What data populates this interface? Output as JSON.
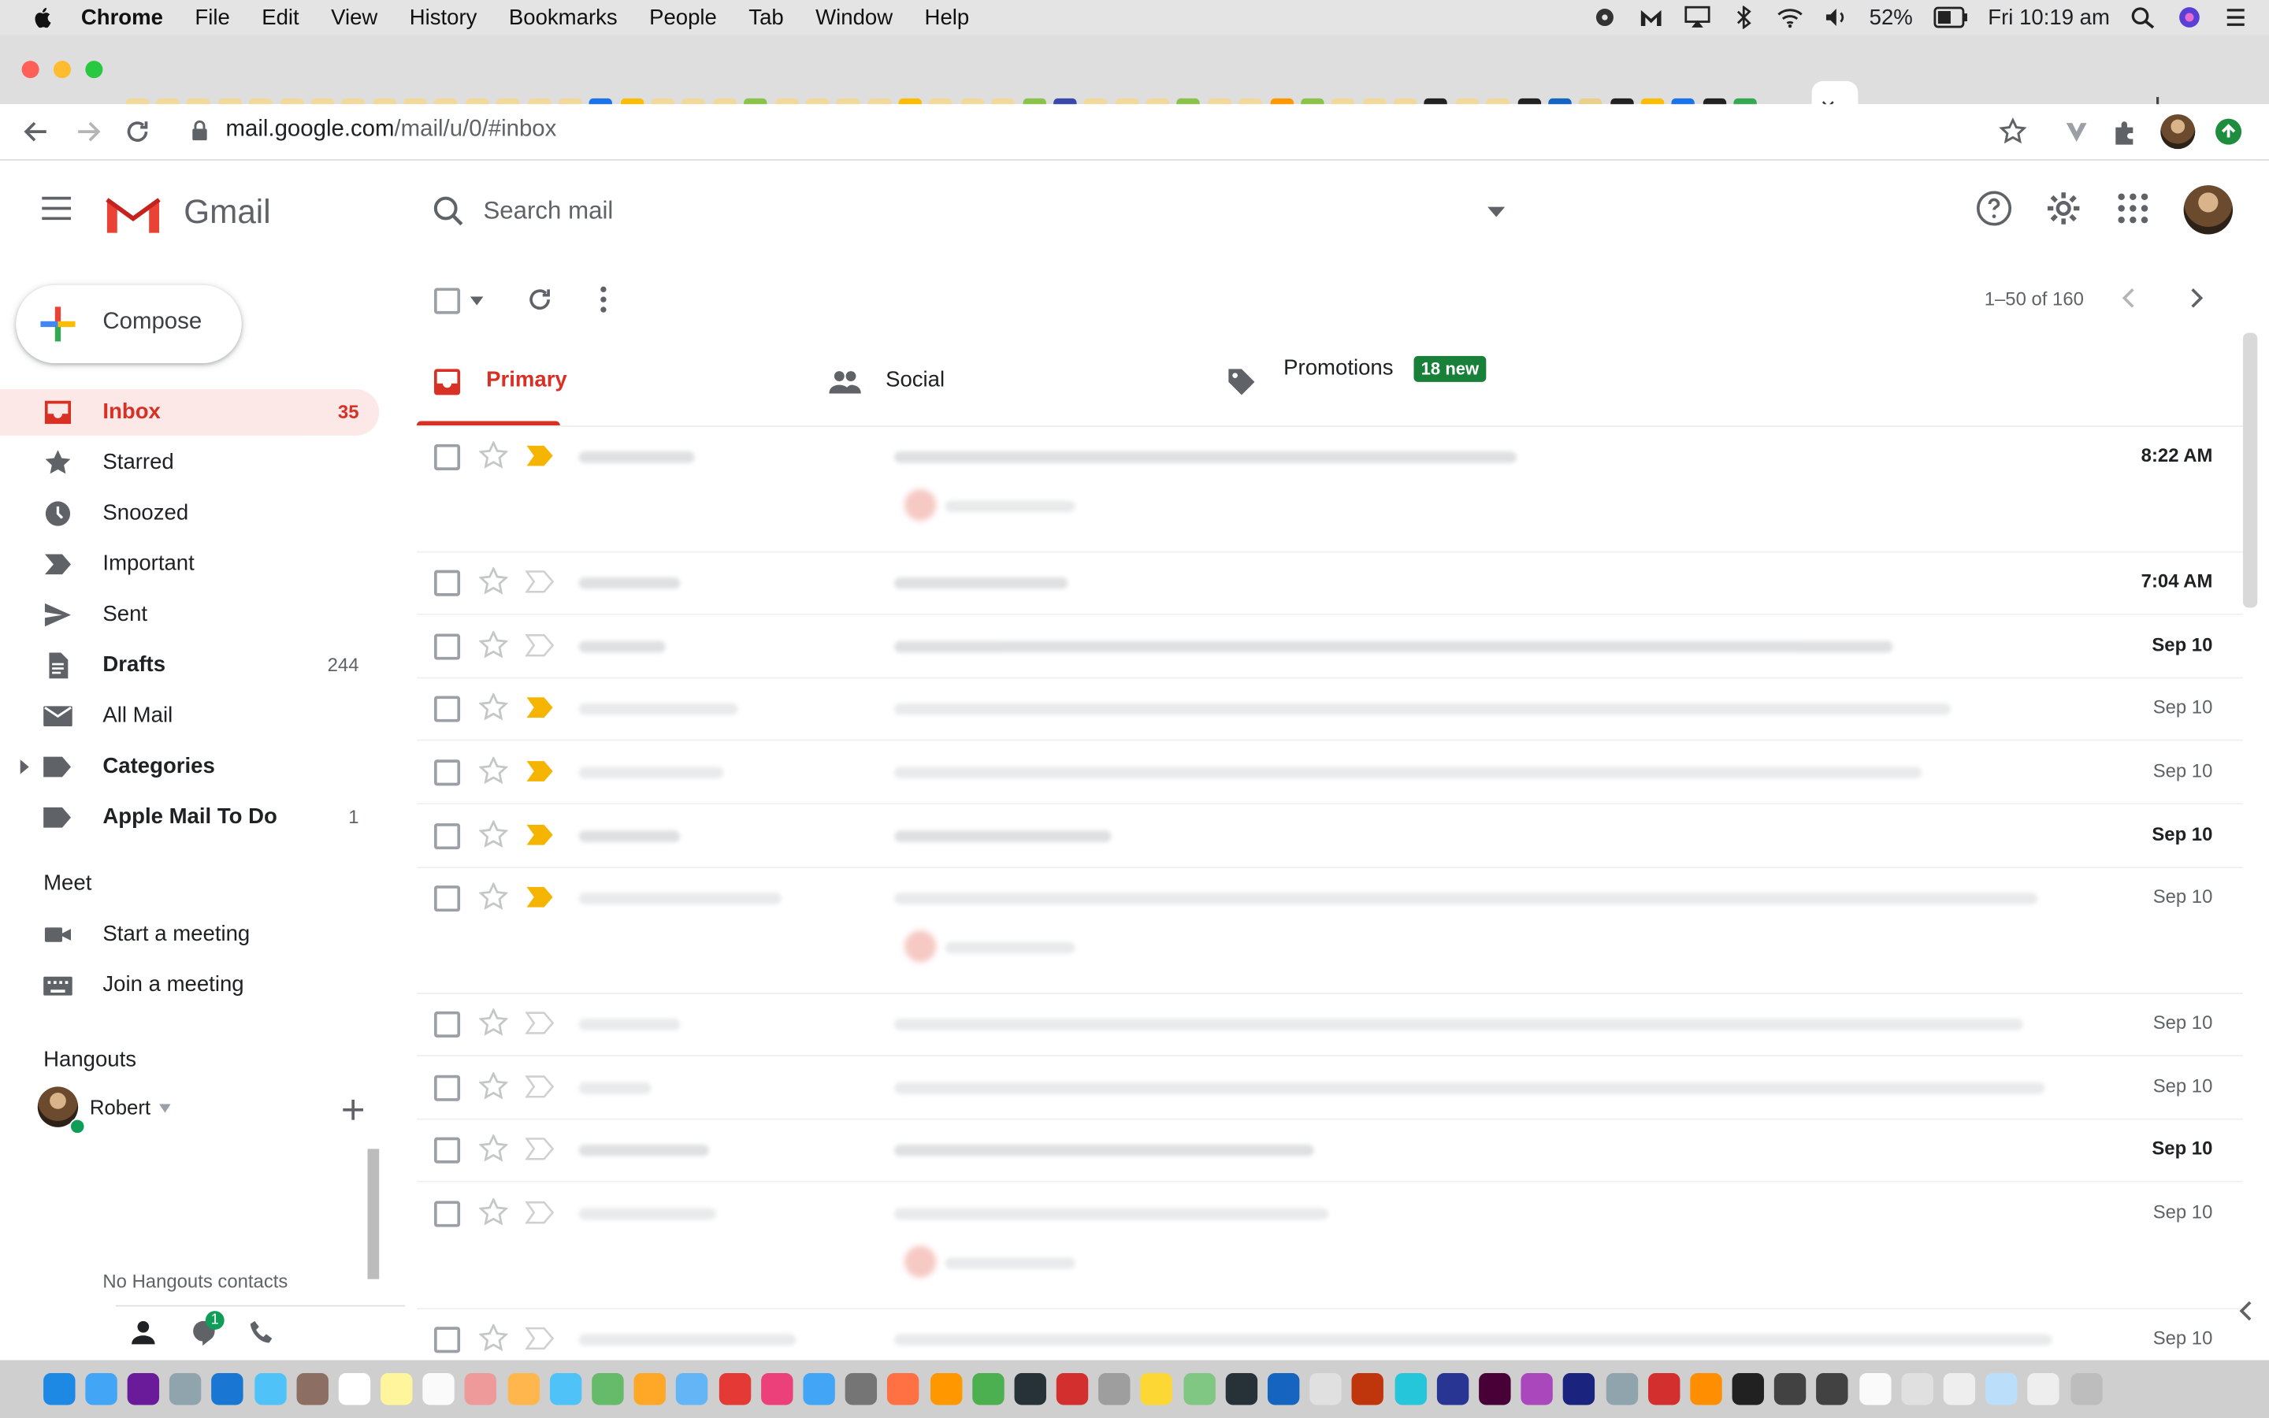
{
  "menubar": {
    "app": "Chrome",
    "items": [
      "File",
      "Edit",
      "View",
      "History",
      "Bookmarks",
      "People",
      "Tab",
      "Window",
      "Help"
    ],
    "battery": "52%",
    "clock": "Fri 10:19 am"
  },
  "browser": {
    "url_host": "mail.google.com",
    "url_path": "/mail/u/0/#inbox",
    "close_tab": "×",
    "new_tab": "+"
  },
  "gmail": {
    "brand": "Gmail",
    "search_placeholder": "Search mail",
    "compose_label": "Compose",
    "nav": [
      {
        "label": "Inbox",
        "count": "35",
        "icon": "inbox-icon"
      },
      {
        "label": "Starred",
        "count": "",
        "icon": "star-icon"
      },
      {
        "label": "Snoozed",
        "count": "",
        "icon": "clock-icon"
      },
      {
        "label": "Important",
        "count": "",
        "icon": "important-icon"
      },
      {
        "label": "Sent",
        "count": "",
        "icon": "send-icon"
      },
      {
        "label": "Drafts",
        "count": "244",
        "icon": "draft-icon"
      },
      {
        "label": "All Mail",
        "count": "",
        "icon": "mail-icon"
      },
      {
        "label": "Categories",
        "count": "",
        "icon": "label-icon"
      },
      {
        "label": "Apple Mail To Do",
        "count": "1",
        "icon": "label-icon"
      }
    ],
    "meet": {
      "heading": "Meet",
      "start": "Start a meeting",
      "join": "Join a meeting"
    },
    "hangouts": {
      "heading": "Hangouts",
      "user": "Robert",
      "empty": "No Hangouts contacts",
      "notif_count": "1"
    },
    "pager": "1–50 of 160",
    "tabs": [
      {
        "label": "Primary"
      },
      {
        "label": "Social"
      },
      {
        "label": "Promotions",
        "badge": "18 new"
      }
    ],
    "rows": [
      {
        "date": "8:22 AM",
        "bold": true,
        "important": true
      },
      {
        "date": "7:04 AM",
        "bold": true,
        "important": false
      },
      {
        "date": "Sep 10",
        "bold": true,
        "important": false
      },
      {
        "date": "Sep 10",
        "bold": false,
        "important": true
      },
      {
        "date": "Sep 10",
        "bold": false,
        "important": true
      },
      {
        "date": "Sep 10",
        "bold": true,
        "important": true
      },
      {
        "date": "Sep 10",
        "bold": false,
        "important": true
      },
      {
        "date": "Sep 10",
        "bold": false,
        "important": false
      },
      {
        "date": "Sep 10",
        "bold": false,
        "important": false
      },
      {
        "date": "Sep 10",
        "bold": true,
        "important": false
      },
      {
        "date": "Sep 10",
        "bold": false,
        "important": false
      },
      {
        "date": "Sep 10",
        "bold": false,
        "important": false
      }
    ]
  },
  "colors": {
    "accent_red": "#d93025",
    "active_bg": "#fce8e6",
    "badge_green": "#188038",
    "important_yellow": "#f4b400"
  }
}
